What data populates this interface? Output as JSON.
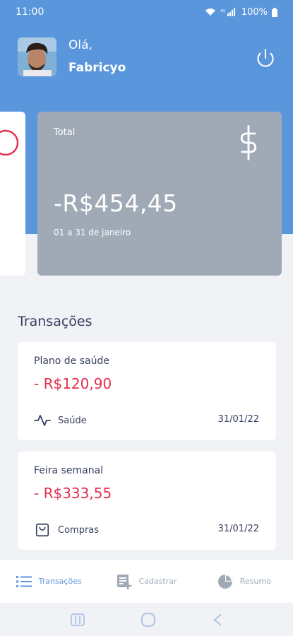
{
  "status_bar": {
    "time": "11:00",
    "battery": "100%"
  },
  "colors": {
    "header": "#5a96dc",
    "total_card": "#a0aab6",
    "negative": "#e52e4d",
    "text": "#363f5f",
    "muted": "#a0aab6"
  },
  "user": {
    "greeting": "Olá,",
    "name": "Fabricyo",
    "avatar_icon": "avatar-photo"
  },
  "summary": {
    "total_label": "Total",
    "total_amount": "-R$454,45",
    "period": "01 a 31 de janeiro",
    "icon": "dollar-icon"
  },
  "transactions": {
    "title": "Transações",
    "items": [
      {
        "title": "Plano de saúde",
        "amount": "- R$120,90",
        "category": "Saúde",
        "category_icon": "activity-icon",
        "date": "31/01/22"
      },
      {
        "title": "Feira semanal",
        "amount": "- R$333,55",
        "category": "Compras",
        "category_icon": "shopping-bag-icon",
        "date": "31/01/22"
      }
    ]
  },
  "bottom_nav": [
    {
      "label": "Transações",
      "icon": "list-icon",
      "active": true
    },
    {
      "label": "Cadastrar",
      "icon": "add-form-icon",
      "active": false
    },
    {
      "label": "Resumo",
      "icon": "pie-chart-icon",
      "active": false
    }
  ]
}
